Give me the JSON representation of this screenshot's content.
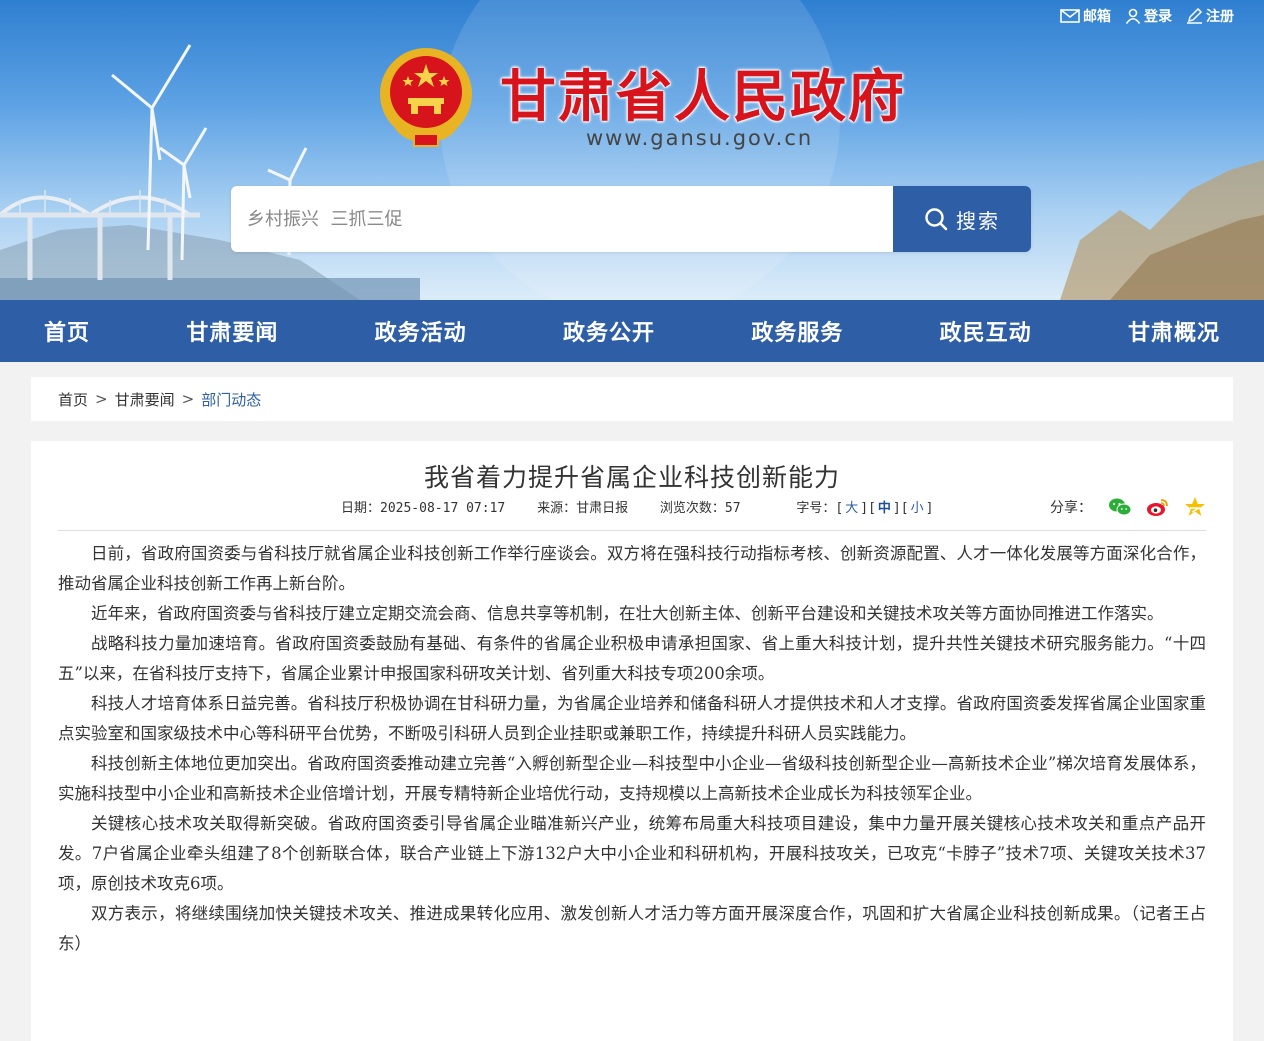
{
  "toplinks": {
    "mail": "邮箱",
    "login": "登录",
    "register": "注册"
  },
  "site": {
    "title": "甘肃省人民政府",
    "url": "www.gansu.gov.cn"
  },
  "search": {
    "placeholder": "乡村振兴  三抓三促",
    "button": "搜索"
  },
  "nav": [
    "首页",
    "甘肃要闻",
    "政务活动",
    "政务公开",
    "政务服务",
    "政民互动",
    "甘肃概况"
  ],
  "breadcrumb": {
    "home": "首页",
    "section": "甘肃要闻",
    "current": "部门动态"
  },
  "article": {
    "title": "我省着力提升省属企业科技创新能力",
    "date": "日期：2025-08-17 07:17",
    "source": "来源：甘肃日报",
    "views": "浏览次数：57",
    "fontsize_label": "字号：",
    "font_large": "大",
    "font_medium": "中",
    "font_small": "小",
    "share_label": "分享：",
    "paragraphs": [
      "日前，省政府国资委与省科技厅就省属企业科技创新工作举行座谈会。双方将在强科技行动指标考核、创新资源配置、人才一体化发展等方面深化合作，推动省属企业科技创新工作再上新台阶。",
      "近年来，省政府国资委与省科技厅建立定期交流会商、信息共享等机制，在壮大创新主体、创新平台建设和关键技术攻关等方面协同推进工作落实。",
      "战略科技力量加速培育。省政府国资委鼓励有基础、有条件的省属企业积极申请承担国家、省上重大科技计划，提升共性关键技术研究服务能力。“十四五”以来，在省科技厅支持下，省属企业累计申报国家科研攻关计划、省列重大科技专项200余项。",
      "科技人才培育体系日益完善。省科技厅积极协调在甘科研力量，为省属企业培养和储备科研人才提供技术和人才支撑。省政府国资委发挥省属企业国家重点实验室和国家级技术中心等科研平台优势，不断吸引科研人员到企业挂职或兼职工作，持续提升科研人员实践能力。",
      "科技创新主体地位更加突出。省政府国资委推动建立完善“入孵创新型企业—科技型中小企业—省级科技创新型企业—高新技术企业”梯次培育发展体系，实施科技型中小企业和高新技术企业倍增计划，开展专精特新企业培优行动，支持规模以上高新技术企业成长为科技领军企业。",
      "关键核心技术攻关取得新突破。省政府国资委引导省属企业瞄准新兴产业，统筹布局重大科技项目建设，集中力量开展关键核心技术攻关和重点产品开发。7户省属企业牵头组建了8个创新联合体，联合产业链上下游132户大中小企业和科研机构，开展科技攻关，已攻克“卡脖子”技术7项、关键攻关技术37项，原创技术攻克6项。",
      "双方表示，将继续围绕加快关键技术攻关、推进成果转化应用、激发创新人才活力等方面开展深度合作，巩固和扩大省属企业科技创新成果。（记者王占东）"
    ]
  }
}
